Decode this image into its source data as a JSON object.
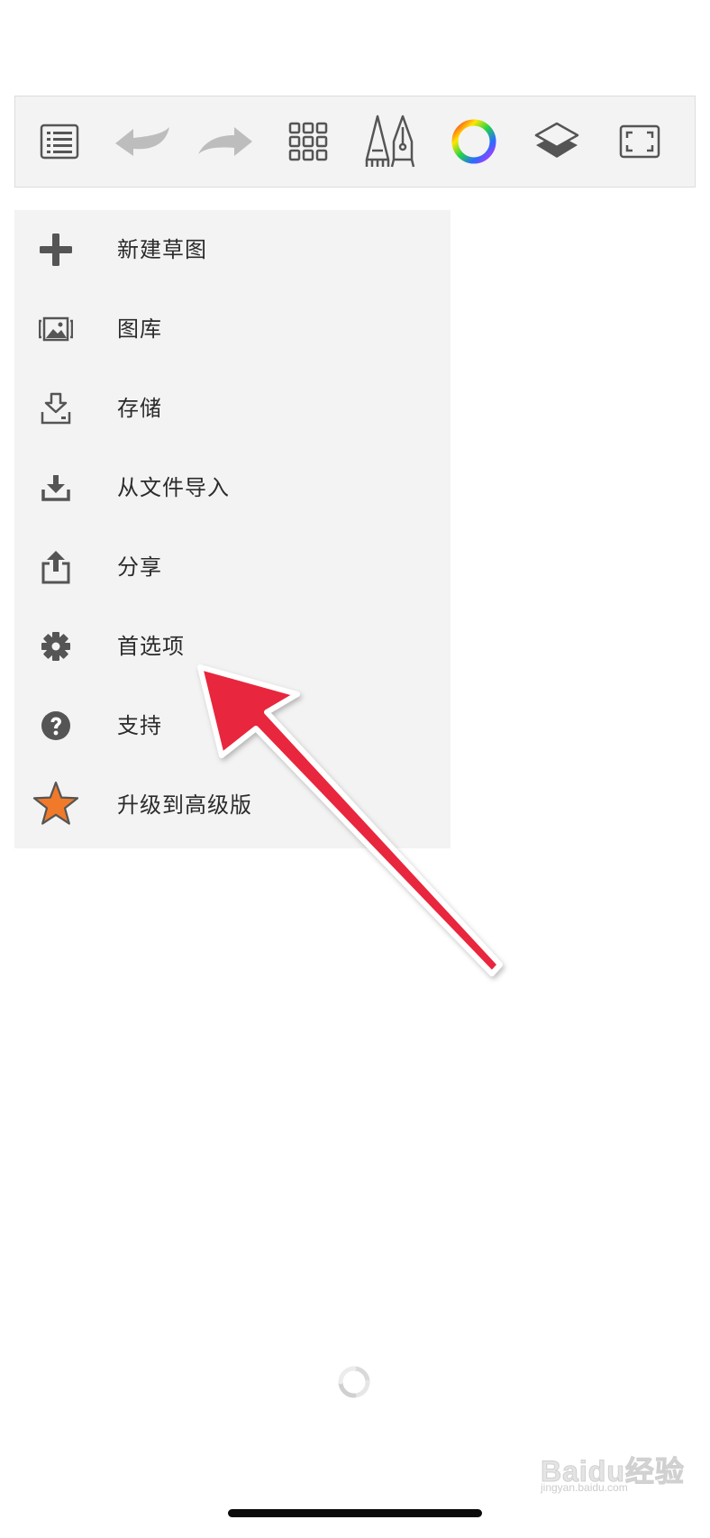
{
  "toolbar": {
    "buttons": [
      {
        "icon": "list-icon"
      },
      {
        "icon": "undo-icon"
      },
      {
        "icon": "redo-icon"
      },
      {
        "icon": "grid-icon"
      },
      {
        "icon": "brushes-icon"
      },
      {
        "icon": "color-wheel-icon"
      },
      {
        "icon": "layers-icon"
      },
      {
        "icon": "fullscreen-icon"
      }
    ]
  },
  "menu": {
    "items": [
      {
        "label": "新建草图",
        "icon": "plus-icon"
      },
      {
        "label": "图库",
        "icon": "gallery-icon"
      },
      {
        "label": "存储",
        "icon": "save-icon"
      },
      {
        "label": "从文件导入",
        "icon": "import-icon"
      },
      {
        "label": "分享",
        "icon": "share-icon"
      },
      {
        "label": "首选项",
        "icon": "gear-icon"
      },
      {
        "label": "支持",
        "icon": "help-icon"
      },
      {
        "label": "升级到高级版",
        "icon": "star-icon"
      }
    ]
  },
  "annotation": {
    "icon": "red-arrow-icon",
    "color": "#e8283c"
  },
  "watermark": {
    "text": "Baidu经验",
    "sub": "jingyan.baidu.com"
  },
  "colors": {
    "toolbar_bg": "#f3f3f3",
    "menu_bg": "#f3f3f3",
    "icon_gray": "#555555",
    "disabled_gray": "#bdbdbd",
    "star_orange": "#f07a2a",
    "arrow_red": "#e8283c"
  }
}
